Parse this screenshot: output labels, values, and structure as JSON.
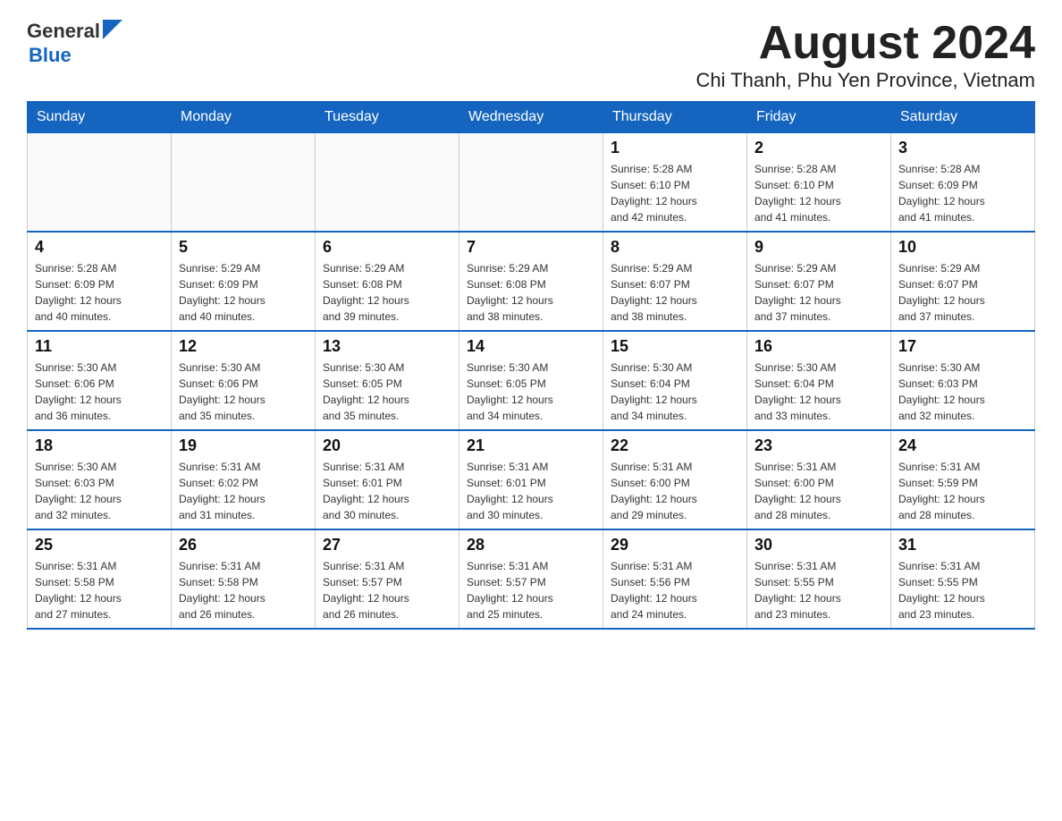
{
  "header": {
    "title": "August 2024",
    "subtitle": "Chi Thanh, Phu Yen Province, Vietnam",
    "logo": {
      "general": "General",
      "blue": "Blue"
    }
  },
  "calendar": {
    "days_of_week": [
      "Sunday",
      "Monday",
      "Tuesday",
      "Wednesday",
      "Thursday",
      "Friday",
      "Saturday"
    ],
    "weeks": [
      [
        {
          "day": "",
          "info": ""
        },
        {
          "day": "",
          "info": ""
        },
        {
          "day": "",
          "info": ""
        },
        {
          "day": "",
          "info": ""
        },
        {
          "day": "1",
          "info": "Sunrise: 5:28 AM\nSunset: 6:10 PM\nDaylight: 12 hours\nand 42 minutes."
        },
        {
          "day": "2",
          "info": "Sunrise: 5:28 AM\nSunset: 6:10 PM\nDaylight: 12 hours\nand 41 minutes."
        },
        {
          "day": "3",
          "info": "Sunrise: 5:28 AM\nSunset: 6:09 PM\nDaylight: 12 hours\nand 41 minutes."
        }
      ],
      [
        {
          "day": "4",
          "info": "Sunrise: 5:28 AM\nSunset: 6:09 PM\nDaylight: 12 hours\nand 40 minutes."
        },
        {
          "day": "5",
          "info": "Sunrise: 5:29 AM\nSunset: 6:09 PM\nDaylight: 12 hours\nand 40 minutes."
        },
        {
          "day": "6",
          "info": "Sunrise: 5:29 AM\nSunset: 6:08 PM\nDaylight: 12 hours\nand 39 minutes."
        },
        {
          "day": "7",
          "info": "Sunrise: 5:29 AM\nSunset: 6:08 PM\nDaylight: 12 hours\nand 38 minutes."
        },
        {
          "day": "8",
          "info": "Sunrise: 5:29 AM\nSunset: 6:07 PM\nDaylight: 12 hours\nand 38 minutes."
        },
        {
          "day": "9",
          "info": "Sunrise: 5:29 AM\nSunset: 6:07 PM\nDaylight: 12 hours\nand 37 minutes."
        },
        {
          "day": "10",
          "info": "Sunrise: 5:29 AM\nSunset: 6:07 PM\nDaylight: 12 hours\nand 37 minutes."
        }
      ],
      [
        {
          "day": "11",
          "info": "Sunrise: 5:30 AM\nSunset: 6:06 PM\nDaylight: 12 hours\nand 36 minutes."
        },
        {
          "day": "12",
          "info": "Sunrise: 5:30 AM\nSunset: 6:06 PM\nDaylight: 12 hours\nand 35 minutes."
        },
        {
          "day": "13",
          "info": "Sunrise: 5:30 AM\nSunset: 6:05 PM\nDaylight: 12 hours\nand 35 minutes."
        },
        {
          "day": "14",
          "info": "Sunrise: 5:30 AM\nSunset: 6:05 PM\nDaylight: 12 hours\nand 34 minutes."
        },
        {
          "day": "15",
          "info": "Sunrise: 5:30 AM\nSunset: 6:04 PM\nDaylight: 12 hours\nand 34 minutes."
        },
        {
          "day": "16",
          "info": "Sunrise: 5:30 AM\nSunset: 6:04 PM\nDaylight: 12 hours\nand 33 minutes."
        },
        {
          "day": "17",
          "info": "Sunrise: 5:30 AM\nSunset: 6:03 PM\nDaylight: 12 hours\nand 32 minutes."
        }
      ],
      [
        {
          "day": "18",
          "info": "Sunrise: 5:30 AM\nSunset: 6:03 PM\nDaylight: 12 hours\nand 32 minutes."
        },
        {
          "day": "19",
          "info": "Sunrise: 5:31 AM\nSunset: 6:02 PM\nDaylight: 12 hours\nand 31 minutes."
        },
        {
          "day": "20",
          "info": "Sunrise: 5:31 AM\nSunset: 6:01 PM\nDaylight: 12 hours\nand 30 minutes."
        },
        {
          "day": "21",
          "info": "Sunrise: 5:31 AM\nSunset: 6:01 PM\nDaylight: 12 hours\nand 30 minutes."
        },
        {
          "day": "22",
          "info": "Sunrise: 5:31 AM\nSunset: 6:00 PM\nDaylight: 12 hours\nand 29 minutes."
        },
        {
          "day": "23",
          "info": "Sunrise: 5:31 AM\nSunset: 6:00 PM\nDaylight: 12 hours\nand 28 minutes."
        },
        {
          "day": "24",
          "info": "Sunrise: 5:31 AM\nSunset: 5:59 PM\nDaylight: 12 hours\nand 28 minutes."
        }
      ],
      [
        {
          "day": "25",
          "info": "Sunrise: 5:31 AM\nSunset: 5:58 PM\nDaylight: 12 hours\nand 27 minutes."
        },
        {
          "day": "26",
          "info": "Sunrise: 5:31 AM\nSunset: 5:58 PM\nDaylight: 12 hours\nand 26 minutes."
        },
        {
          "day": "27",
          "info": "Sunrise: 5:31 AM\nSunset: 5:57 PM\nDaylight: 12 hours\nand 26 minutes."
        },
        {
          "day": "28",
          "info": "Sunrise: 5:31 AM\nSunset: 5:57 PM\nDaylight: 12 hours\nand 25 minutes."
        },
        {
          "day": "29",
          "info": "Sunrise: 5:31 AM\nSunset: 5:56 PM\nDaylight: 12 hours\nand 24 minutes."
        },
        {
          "day": "30",
          "info": "Sunrise: 5:31 AM\nSunset: 5:55 PM\nDaylight: 12 hours\nand 23 minutes."
        },
        {
          "day": "31",
          "info": "Sunrise: 5:31 AM\nSunset: 5:55 PM\nDaylight: 12 hours\nand 23 minutes."
        }
      ]
    ]
  }
}
